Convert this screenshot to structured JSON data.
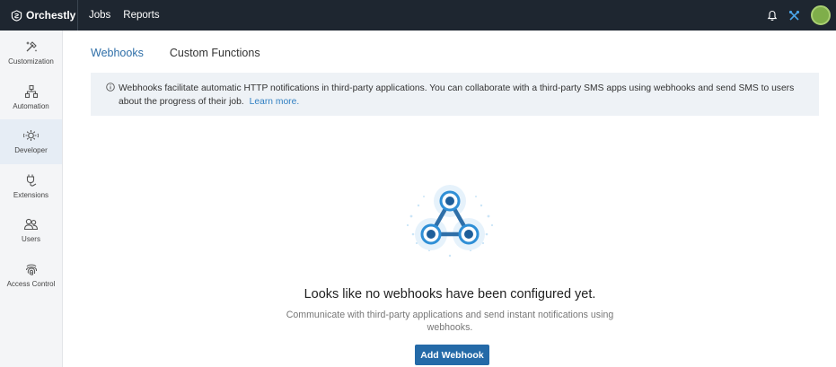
{
  "app": {
    "name": "Orchestly"
  },
  "topnav": {
    "items": [
      {
        "label": "Jobs"
      },
      {
        "label": "Reports"
      }
    ]
  },
  "icons": {
    "notification": "bell-icon",
    "tools": "tools-icon",
    "avatar": "user-avatar"
  },
  "colors": {
    "topbar": "#1e2630",
    "accent": "#2f6fa8",
    "button": "#246aa8",
    "avatar": "#7fae4a"
  },
  "sidebar": {
    "items": [
      {
        "label": "Customization",
        "icon": "wand-icon"
      },
      {
        "label": "Automation",
        "icon": "flow-icon"
      },
      {
        "label": "Developer",
        "icon": "developer-icon",
        "active": true
      },
      {
        "label": "Extensions",
        "icon": "plug-icon"
      },
      {
        "label": "Users",
        "icon": "users-icon"
      },
      {
        "label": "Access Control",
        "icon": "fingerprint-icon"
      }
    ]
  },
  "tabs": [
    {
      "label": "Webhooks",
      "active": true
    },
    {
      "label": "Custom Functions"
    }
  ],
  "info": {
    "text": "Webhooks facilitate automatic HTTP notifications in third-party applications. You can collaborate with a third-party SMS apps using webhooks and send SMS to users about the progress of their job.",
    "link": "Learn more."
  },
  "empty_state": {
    "title": "Looks like no webhooks have been configured yet.",
    "description": "Communicate with third-party applications and send instant notifications using webhooks.",
    "button": "Add Webhook"
  }
}
